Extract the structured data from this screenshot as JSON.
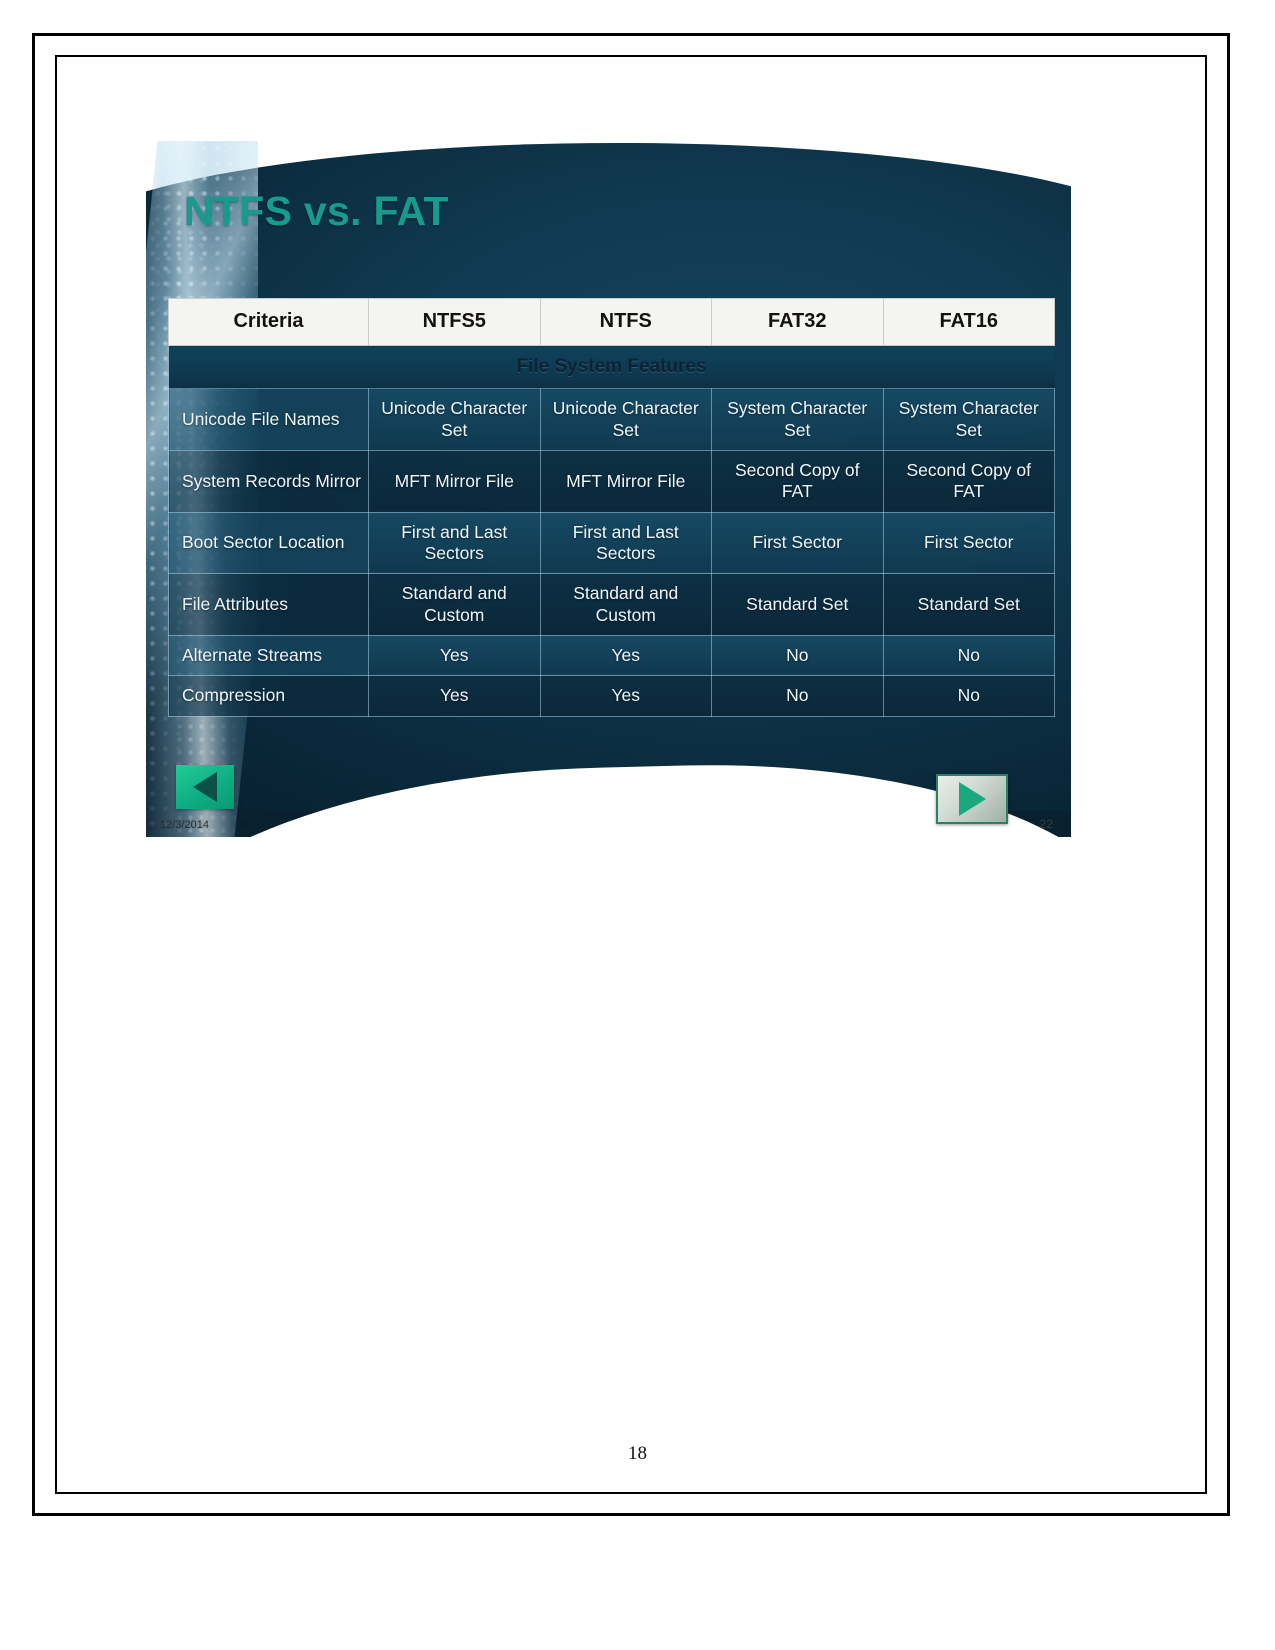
{
  "document": {
    "page_number": "18"
  },
  "slide": {
    "title": "NTFS vs. FAT",
    "date": "12/3/2014",
    "slide_number": "22",
    "nav": {
      "prev_label": "Previous slide",
      "next_label": "Next slide"
    },
    "colors": {
      "title_teal": "#169b8c",
      "slide_bg_dark": "#0c2b3d",
      "prev_button_green": "#12b387",
      "header_row_bg": "#f4f5f3"
    }
  },
  "chart_data": {
    "type": "table",
    "title": "NTFS vs. FAT",
    "columns": [
      "Criteria",
      "NTFS5",
      "NTFS",
      "FAT32",
      "FAT16"
    ],
    "sections": [
      {
        "label": "File System Features",
        "rows": [
          {
            "criteria": "Unicode File Names",
            "values": [
              "Unicode Character Set",
              "Unicode Character Set",
              "System Character Set",
              "System Character Set"
            ]
          },
          {
            "criteria": "System Records Mirror",
            "values": [
              "MFT Mirror File",
              "MFT Mirror File",
              "Second Copy of  FAT",
              "Second Copy of  FAT"
            ]
          },
          {
            "criteria": "Boot Sector Location",
            "values": [
              "First and Last Sectors",
              "First and Last Sectors",
              "First Sector",
              "First Sector"
            ]
          },
          {
            "criteria": "File Attributes",
            "values": [
              "Standard and Custom",
              "Standard and Custom",
              "Standard Set",
              "Standard Set"
            ]
          },
          {
            "criteria": "Alternate Streams",
            "values": [
              "Yes",
              "Yes",
              "No",
              "No"
            ]
          },
          {
            "criteria": "Compression",
            "values": [
              "Yes",
              "Yes",
              "No",
              "No"
            ]
          }
        ]
      }
    ]
  }
}
